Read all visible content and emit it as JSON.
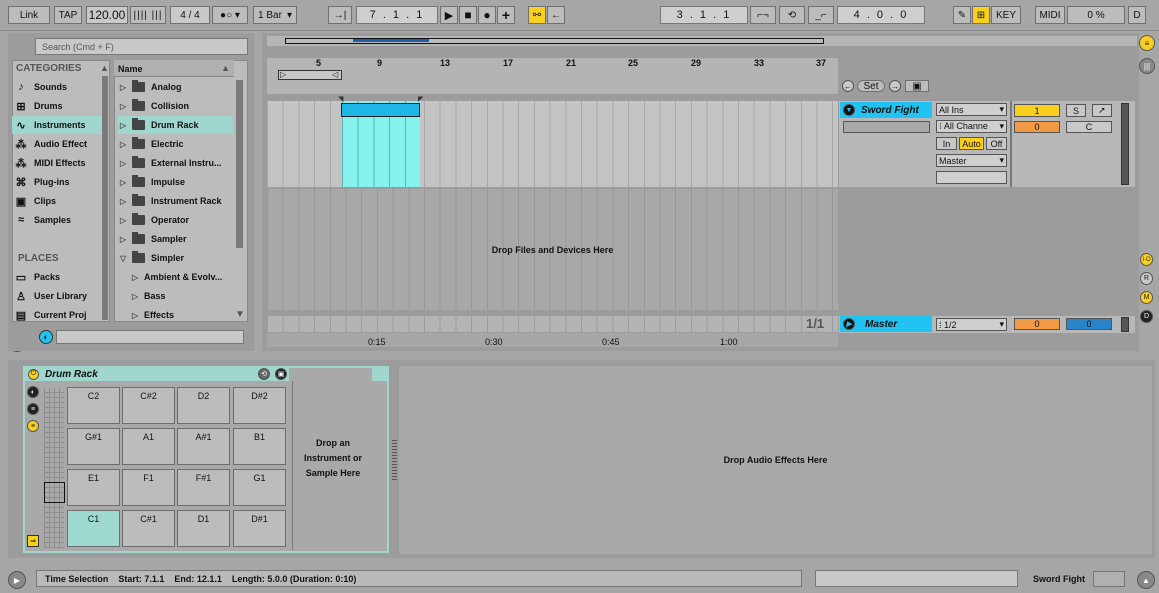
{
  "transport": {
    "link": "Link",
    "tap": "TAP",
    "tempo": "120.00",
    "time_sig": "4 / 4",
    "quant": "1 Bar",
    "position": "7 .  1 .  1",
    "loop_start": "3 .  1 .  1",
    "loop_length": "4 .  0 .  0",
    "key": "KEY",
    "midi": "MIDI",
    "cpu": "0 %",
    "disk": "D"
  },
  "browser": {
    "search_placeholder": "Search (Cmd + F)",
    "categories_header": "CATEGORIES",
    "categories": [
      {
        "label": "Sounds",
        "icon": "note-icon"
      },
      {
        "label": "Drums",
        "icon": "grid-icon"
      },
      {
        "label": "Instruments",
        "icon": "wave-icon"
      },
      {
        "label": "Audio Effect",
        "icon": "fx-icon"
      },
      {
        "label": "MIDI Effects",
        "icon": "fx-icon"
      },
      {
        "label": "Plug-ins",
        "icon": "plug-icon"
      },
      {
        "label": "Clips",
        "icon": "clip-icon"
      },
      {
        "label": "Samples",
        "icon": "sample-icon"
      }
    ],
    "places_header": "PLACES",
    "places": [
      {
        "label": "Packs",
        "icon": "pack-icon"
      },
      {
        "label": "User Library",
        "icon": "user-icon"
      },
      {
        "label": "Current Proj",
        "icon": "folder-icon"
      }
    ],
    "name_header": "Name",
    "items": [
      {
        "label": "Analog",
        "type": "folder"
      },
      {
        "label": "Collision",
        "type": "folder"
      },
      {
        "label": "Drum Rack",
        "type": "folder"
      },
      {
        "label": "Electric",
        "type": "folder"
      },
      {
        "label": "External Instru...",
        "type": "folder"
      },
      {
        "label": "Impulse",
        "type": "folder"
      },
      {
        "label": "Instrument Rack",
        "type": "folder"
      },
      {
        "label": "Operator",
        "type": "folder"
      },
      {
        "label": "Sampler",
        "type": "folder"
      },
      {
        "label": "Simpler",
        "type": "folder-open"
      },
      {
        "label": "Ambient & Evolv...",
        "type": "sub"
      },
      {
        "label": "Bass",
        "type": "sub"
      },
      {
        "label": "Effects",
        "type": "sub"
      }
    ]
  },
  "arrangement": {
    "bar_numbers": [
      "5",
      "9",
      "13",
      "17",
      "21",
      "25",
      "29",
      "33",
      "37"
    ],
    "drop_files": "Drop Files and Devices Here",
    "time_labels": [
      "0:15",
      "0:30",
      "0:45",
      "1:00"
    ],
    "page_indicator": "1/1",
    "set_label": "Set"
  },
  "track": {
    "name": "Sword Fight",
    "input": "All Ins",
    "channel": "All Channe",
    "monitor_in": "In",
    "monitor_auto": "Auto",
    "monitor_off": "Off",
    "output": "Master",
    "number": "1",
    "solo": "S",
    "volume": "0",
    "pan": "C"
  },
  "master": {
    "name": "Master",
    "cue": "1/2",
    "volume": "0",
    "pan": "0"
  },
  "drum_rack": {
    "title": "Drum Rack",
    "pads": [
      [
        "C2",
        "C#2",
        "D2",
        "D#2"
      ],
      [
        "G#1",
        "A1",
        "A#1",
        "B1"
      ],
      [
        "E1",
        "F1",
        "F#1",
        "G1"
      ],
      [
        "C1",
        "C#1",
        "D1",
        "D#1"
      ]
    ],
    "drop_instrument": "Drop an Instrument or Sample Here",
    "drop_effects": "Drop Audio Effects Here"
  },
  "status": {
    "selection": "Time Selection",
    "start": "Start: 7.1.1",
    "end": "End: 12.1.1",
    "length": "Length: 5.0.0 (Duration: 0:10)",
    "track_name": "Sword Fight"
  },
  "side_labels": {
    "io": "I·O",
    "r": "R",
    "m": "M",
    "d": "D"
  },
  "colors": {
    "accent_blue": "#1fb6e8",
    "clip_fill": "#86f2ee",
    "track_header": "#21c3f2",
    "orange": "#f29b47",
    "yellow": "#f9d01e",
    "selected_row": "#9fd6cd"
  }
}
